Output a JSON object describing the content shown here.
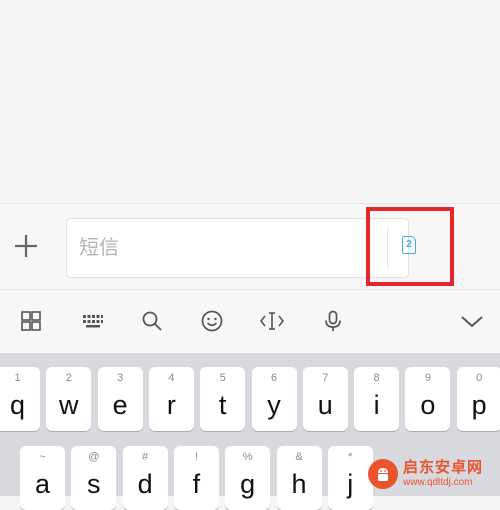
{
  "compose": {
    "placeholder": "短信",
    "sim_label": "2"
  },
  "toolbar": {
    "items": [
      "grid-icon",
      "keyboard-icon",
      "search-icon",
      "emoji-icon",
      "cursor-icon",
      "microphone-icon",
      "chevron-down-icon"
    ]
  },
  "keyboard": {
    "row1": [
      {
        "num": "1",
        "ch": "q"
      },
      {
        "num": "2",
        "ch": "w"
      },
      {
        "num": "3",
        "ch": "e"
      },
      {
        "num": "4",
        "ch": "r"
      },
      {
        "num": "5",
        "ch": "t"
      },
      {
        "num": "6",
        "ch": "y"
      },
      {
        "num": "7",
        "ch": "u"
      },
      {
        "num": "8",
        "ch": "i"
      },
      {
        "num": "9",
        "ch": "o"
      },
      {
        "num": "0",
        "ch": "p"
      }
    ],
    "row2": [
      {
        "num": "~",
        "ch": "a"
      },
      {
        "num": "@",
        "ch": "s"
      },
      {
        "num": "#",
        "ch": "d"
      },
      {
        "num": "!",
        "ch": "f"
      },
      {
        "num": "%",
        "ch": "g"
      },
      {
        "num": "&",
        "ch": "h"
      },
      {
        "num": "*",
        "ch": "j"
      }
    ]
  },
  "watermark": {
    "title": "启东安卓网",
    "url": "www.qdltdj.com"
  },
  "colors": {
    "highlight": "#e6262b",
    "sim_blue": "#4aa8e0",
    "watermark": "#e9542f"
  }
}
